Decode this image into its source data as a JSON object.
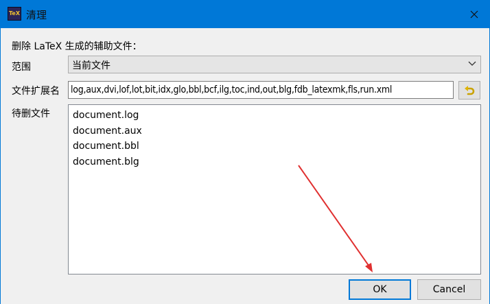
{
  "window": {
    "title": "清理",
    "app_icon_text": "TeX",
    "accent_color": "#0078d7"
  },
  "dialog": {
    "description": "删除 LaTeX 生成的辅助文件：",
    "scope_label": "范围",
    "scope_value": "当前文件",
    "extensions_label": "文件扩展名",
    "extensions_value": "log,aux,dvi,lof,lot,bit,idx,glo,bbl,bcf,ilg,toc,ind,out,blg,fdb_latexmk,fls,run.xml",
    "files_label": "待删文件",
    "files": [
      "document.log",
      "document.aux",
      "document.bbl",
      "document.blg"
    ],
    "ok_label": "OK",
    "cancel_label": "Cancel"
  },
  "annotation": {
    "arrow_color": "#e03030"
  }
}
